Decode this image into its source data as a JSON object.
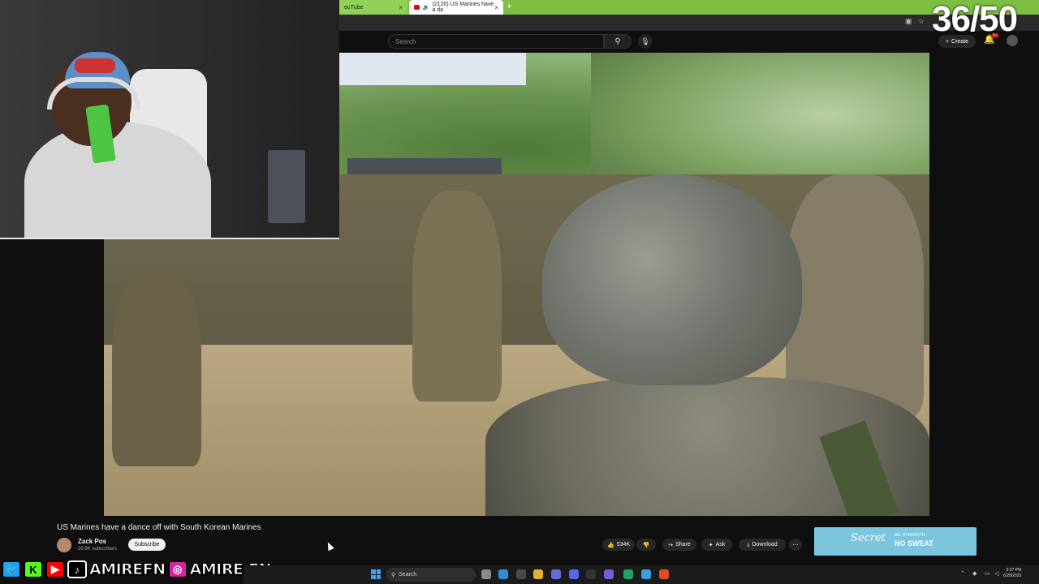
{
  "browser": {
    "tab1_title": "ouTube",
    "tab2_title": "(2120) US Marines have a da",
    "close_glyph": "×",
    "new_tab_glyph": "+"
  },
  "counter": "36/50",
  "youtube": {
    "search_placeholder": "Search",
    "create_label": "Create",
    "notification_count": "9+"
  },
  "video": {
    "title": "US Marines have a dance off with South Korean Marines",
    "channel_name": "Zack Pos",
    "subscribers": "29.9K subscribers",
    "subscribe_label": "Subscribe",
    "like_count": "534K",
    "share_label": "Share",
    "ask_label": "Ask",
    "download_label": "Download"
  },
  "ad": {
    "brand": "Secret",
    "tagline_small": "ALL STRENGTH",
    "tagline_big": "NO SWEAT"
  },
  "socials": {
    "handle_1": "AMIREFN",
    "handle_2": "AMIRE.FN"
  },
  "taskbar": {
    "search_label": "Search",
    "time": "9:37 PM",
    "date": "6/28/2025"
  },
  "colors": {
    "browser_tabbar": "#7bc043",
    "yt_background": "#0f0f0f",
    "ad_background": "#7cc5df"
  },
  "icons": [
    "search-icon",
    "mic-icon",
    "bell-icon",
    "like-icon",
    "dislike-icon",
    "share-icon",
    "download-icon",
    "windows-icon"
  ]
}
